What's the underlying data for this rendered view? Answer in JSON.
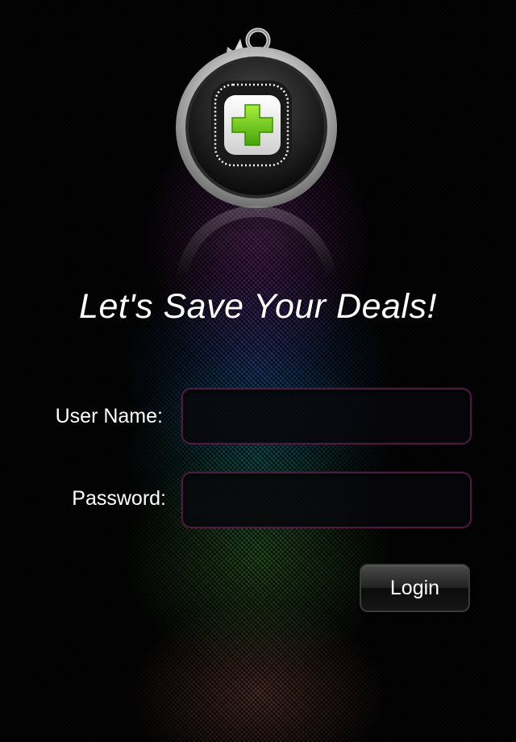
{
  "app": {
    "logo_icon": "green-plus-badge-icon",
    "headline": "Let's Save Your Deals!"
  },
  "form": {
    "username_label": "User Name:",
    "username_value": "",
    "password_label": "Password:",
    "password_value": "",
    "login_label": "Login"
  },
  "colors": {
    "background": "#050505",
    "plus_green": "#6cc21a",
    "field_border": "#4a1b3d",
    "text": "#ffffff"
  }
}
